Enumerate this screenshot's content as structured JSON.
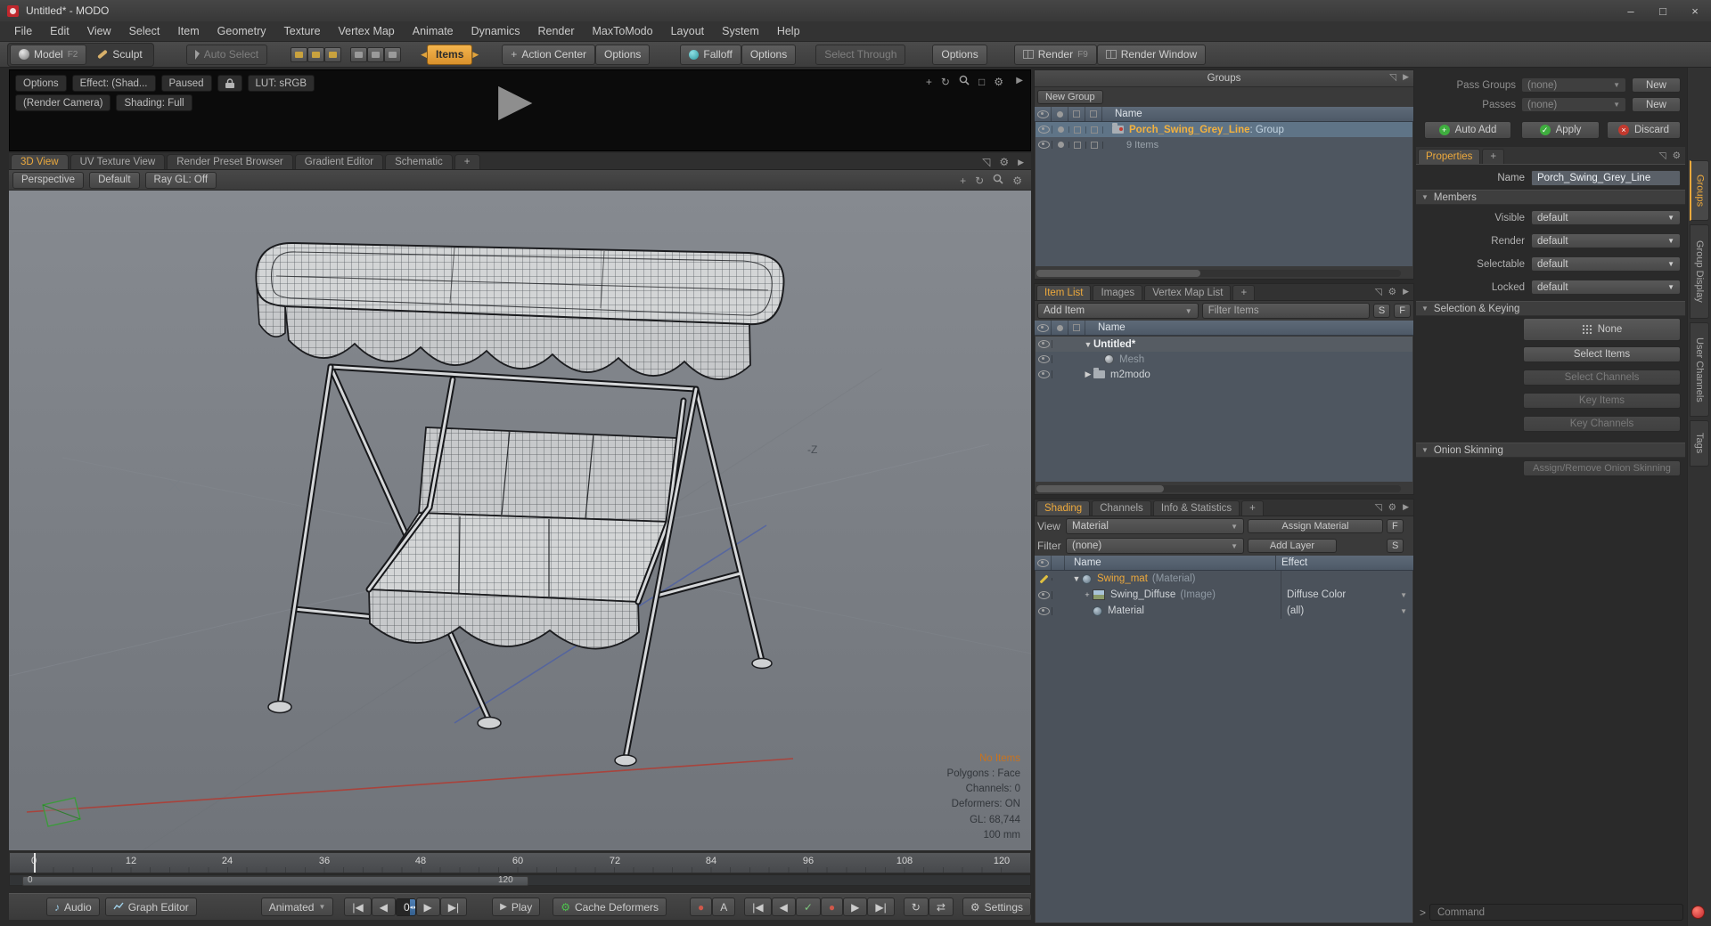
{
  "window": {
    "title": "Untitled* - MODO"
  },
  "menu": [
    "File",
    "Edit",
    "View",
    "Select",
    "Item",
    "Geometry",
    "Texture",
    "Vertex Map",
    "Animate",
    "Dynamics",
    "Render",
    "MaxToModo",
    "Layout",
    "System",
    "Help"
  ],
  "toolbar": {
    "model": "Model",
    "model_key": "F2",
    "sculpt": "Sculpt",
    "auto_select": "Auto Select",
    "items": "Items",
    "action_center": "Action Center",
    "options_select": "Options",
    "falloff": "Falloff",
    "options_falloff": "Options",
    "select_through": "Select Through",
    "options_select_through": "Options",
    "render": "Render",
    "render_key": "F9",
    "render_window": "Render Window"
  },
  "preview": {
    "options": "Options",
    "effect": "Effect: (Shad...",
    "paused": "Paused",
    "lut": "LUT: sRGB",
    "render_camera": "(Render Camera)",
    "shading_mode": "Shading: Full"
  },
  "view_tabs": {
    "tabs": [
      "3D View",
      "UV Texture View",
      "Render Preset Browser",
      "Gradient Editor",
      "Schematic"
    ],
    "add_tab": "+"
  },
  "viewport": {
    "perspective": "Perspective",
    "style": "Default",
    "raygl": "Ray GL: Off",
    "axis_label": "-Z",
    "stats": {
      "no_items": "No Items",
      "polygons": "Polygons : Face",
      "channels": "Channels: 0",
      "deformers": "Deformers: ON",
      "gl": "GL: 68,744",
      "scale": "100 mm"
    }
  },
  "timeline": {
    "ticks": [
      "0",
      "12",
      "24",
      "36",
      "48",
      "60",
      "72",
      "84",
      "96",
      "108",
      "120"
    ],
    "range_start": "0",
    "range_end": "120"
  },
  "transport": {
    "audio": "Audio",
    "graph_editor": "Graph Editor",
    "anim_mode": "Animated",
    "frame": "0",
    "play": "Play",
    "cache_deformers": "Cache Deformers",
    "settings": "Settings"
  },
  "groups_panel": {
    "title": "Groups",
    "new_group": "New Group",
    "col_name": "Name",
    "group_name": "Porch_Swing_Grey_Line",
    "group_suffix": " : Group",
    "items_count": "9 Items"
  },
  "item_list": {
    "tabs": [
      "Item List",
      "Images",
      "Vertex Map List"
    ],
    "add_tab": "+",
    "add_item": "Add Item",
    "filter": "Filter Items",
    "s": "S",
    "f": "F",
    "col_name": "Name",
    "rows": [
      {
        "name": "Untitled*"
      },
      {
        "name": "Mesh"
      },
      {
        "name": "m2modo"
      }
    ]
  },
  "shading": {
    "tabs": [
      "Shading",
      "Channels",
      "Info & Statistics"
    ],
    "add_tab": "+",
    "view_label": "View",
    "view_value": "Material",
    "assign_material": "Assign Material",
    "f": "F",
    "filter_label": "Filter",
    "filter_value": "(none)",
    "add_layer": "Add Layer",
    "s": "S",
    "col_name": "Name",
    "col_effect": "Effect",
    "rows": [
      {
        "name": "Swing_mat",
        "suffix": "(Material)",
        "effect": ""
      },
      {
        "name": "Swing_Diffuse",
        "suffix": "(Image)",
        "effect": "Diffuse Color"
      },
      {
        "name": "Material",
        "suffix": "",
        "effect": "(all)"
      }
    ]
  },
  "properties": {
    "pass_groups_label": "Pass Groups",
    "pass_groups_value": "(none)",
    "new_pass_group": "New",
    "passes_label": "Passes",
    "passes_value": "(none)",
    "new_pass": "New",
    "auto_add": "Auto Add",
    "apply": "Apply",
    "discard": "Discard",
    "tab": "Properties",
    "add_tab": "+",
    "name_label": "Name",
    "name_value": "Porch_Swing_Grey_Line",
    "members_header": "Members",
    "member_rows": [
      {
        "label": "Visible",
        "value": "default"
      },
      {
        "label": "Render",
        "value": "default"
      },
      {
        "label": "Selectable",
        "value": "default"
      },
      {
        "label": "Locked",
        "value": "default"
      }
    ],
    "selection_header": "Selection & Keying",
    "none_button": "None",
    "select_items": "Select Items",
    "select_channels": "Select Channels",
    "key_items": "Key Items",
    "key_channels": "Key Channels",
    "onion_header": "Onion Skinning",
    "assign_onion": "Assign/Remove Onion Skinning"
  },
  "side_tabs": [
    "Groups",
    "Group Display",
    "User Channels",
    "Tags"
  ],
  "command": {
    "prompt": ">",
    "placeholder": "Command"
  },
  "colors": {
    "accent_orange": "#eda93c",
    "accent_teal": "#38b8c0",
    "selection_blue": "#5f7487",
    "viewport_grey": "#7b7f86"
  },
  "icons": {
    "win_min": "–",
    "win_max": "□",
    "win_close": "×",
    "play": "▶",
    "gear": "⚙",
    "expand": "◹",
    "panel_arrow": "▶",
    "tri_down": "▼",
    "tri_right": "▶",
    "orbit": "↻",
    "pan": "+",
    "first": "|◀",
    "prev": "◀",
    "next": "▶",
    "last": "▶|",
    "note": "♪",
    "check": "✓",
    "record": "●",
    "loop": "↻",
    "swap": "⇄",
    "autokey": "A",
    "dropdown": "▼",
    "plus": "+",
    "spin": "◂▸",
    "cross": "×"
  }
}
